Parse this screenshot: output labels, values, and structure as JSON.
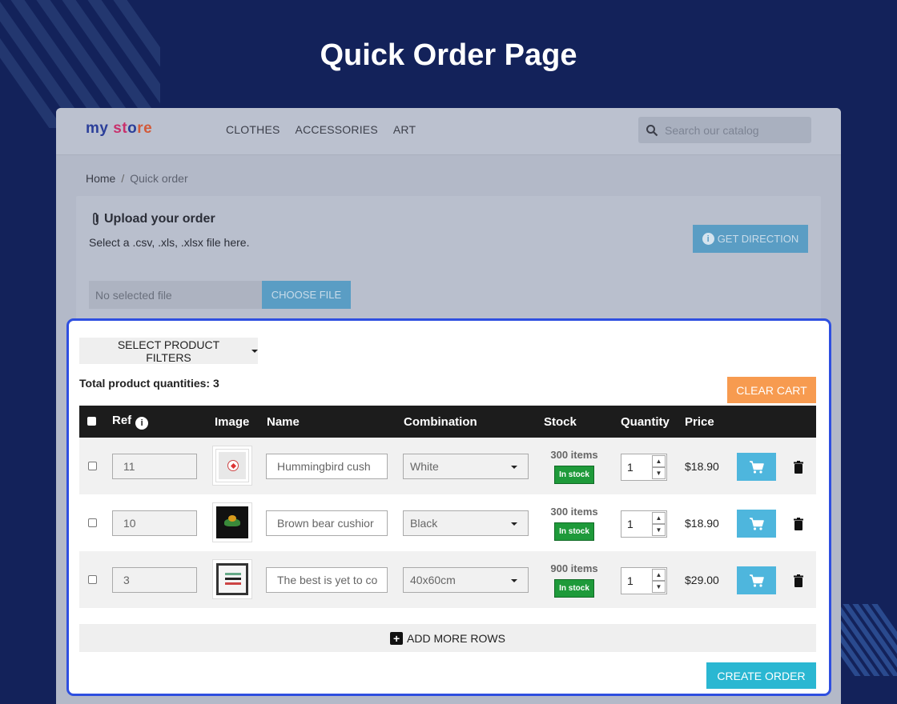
{
  "page": {
    "title": "Quick Order Page"
  },
  "store": {
    "logo": {
      "part1": "my",
      "part2": "st",
      "part3": "o",
      "part4": "re"
    },
    "nav": [
      "CLOTHES",
      "ACCESSORIES",
      "ART"
    ],
    "search_placeholder": "Search our catalog"
  },
  "breadcrumb": {
    "home": "Home",
    "separator": "/",
    "current": "Quick order"
  },
  "upload": {
    "title": "Upload your order",
    "subtitle": "Select a .csv, .xls, .xlsx file here.",
    "get_direction_label": "GET DIRECTION",
    "file_value": "No selected file",
    "choose_file_label": "CHOOSE FILE"
  },
  "quick_order": {
    "filters_label": "SELECT PRODUCT FILTERS",
    "total_label": "Total product quantities: 3",
    "clear_cart_label": "CLEAR CART",
    "columns": {
      "ref": "Ref",
      "image": "Image",
      "name": "Name",
      "combination": "Combination",
      "stock": "Stock",
      "quantity": "Quantity",
      "price": "Price"
    },
    "rows": [
      {
        "ref": "11",
        "image": "hummingbird-cushion",
        "name": "Hummingbird cush",
        "combination": "White",
        "stock": "300 items",
        "badge": "In stock",
        "qty": "1",
        "price": "$18.90"
      },
      {
        "ref": "10",
        "image": "brown-bear-cushion",
        "name": "Brown bear cushior",
        "combination": "Black",
        "stock": "300 items",
        "badge": "In stock",
        "qty": "1",
        "price": "$18.90"
      },
      {
        "ref": "3",
        "image": "poster-best-is-yet",
        "name": "The best is yet to co",
        "combination": "40x60cm",
        "stock": "900 items",
        "badge": "In stock",
        "qty": "1",
        "price": "$29.00"
      }
    ],
    "add_rows_label": "ADD MORE ROWS",
    "create_order_label": "CREATE ORDER"
  },
  "colors": {
    "background": "#13225a",
    "card_border": "#2e4fe0",
    "clear_cart": "#f79b50",
    "cart_button": "#4eb6dd",
    "create_order": "#2ab7d2",
    "in_stock": "#1e9a3a"
  },
  "icons": [
    "search-icon",
    "paperclip-icon",
    "info-icon",
    "cart-icon",
    "trash-icon",
    "plus-icon",
    "caret-down-icon"
  ]
}
